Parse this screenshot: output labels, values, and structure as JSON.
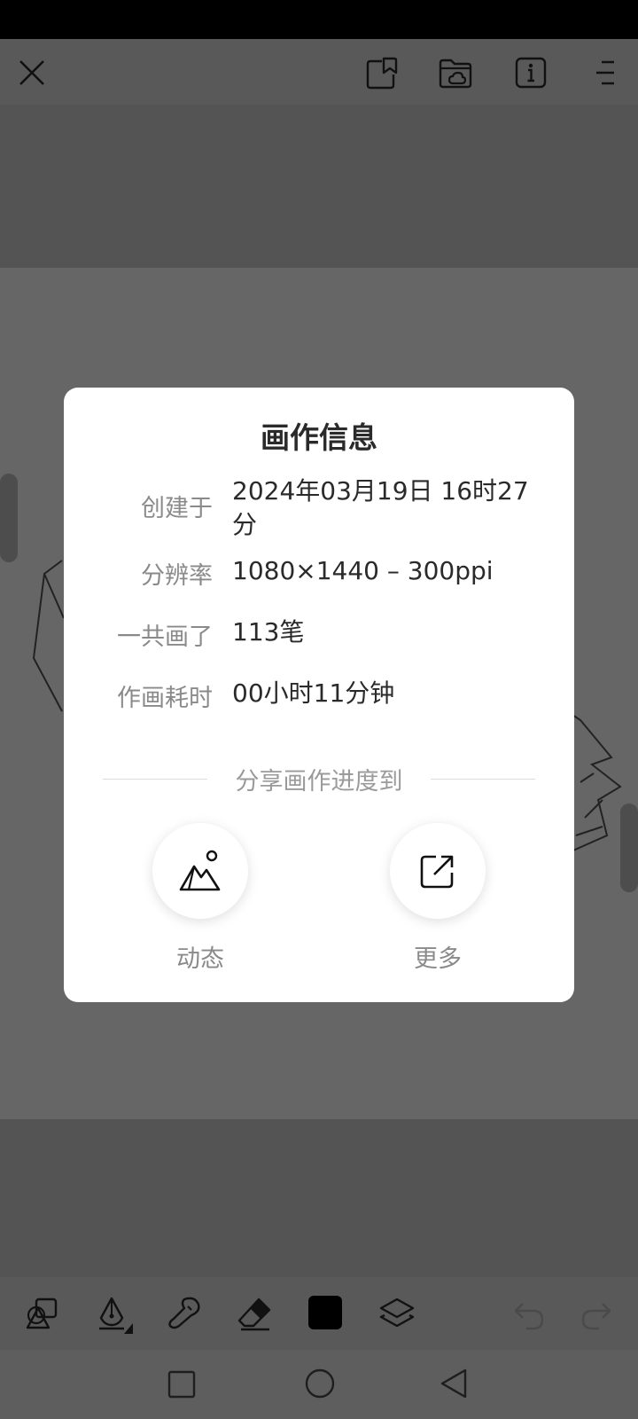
{
  "dialog": {
    "title": "画作信息",
    "rows": [
      {
        "label": "创建于",
        "value": "2024年03月19日 16时27分"
      },
      {
        "label": "分辨率",
        "value": "1080×1440 – 300ppi"
      },
      {
        "label": "一共画了",
        "value": "113笔"
      },
      {
        "label": "作画耗时",
        "value": "00小时11分钟"
      }
    ],
    "share_heading": "分享画作进度到",
    "share_options": [
      {
        "label": "动态",
        "icon": "landscape-icon"
      },
      {
        "label": "更多",
        "icon": "share-external-icon"
      }
    ]
  },
  "top_toolbar": {
    "icons": [
      "close-icon",
      "gallery-icon",
      "folder-cloud-icon",
      "info-icon",
      "menu-icon"
    ]
  },
  "bottom_toolbar": {
    "tools": [
      "shapes-icon",
      "pen-icon",
      "smudge-icon",
      "eraser-icon",
      "color-swatch",
      "layers-icon",
      "undo-icon",
      "redo-icon"
    ],
    "current_color": "#000000"
  },
  "nav": {
    "icons": [
      "recents-square-icon",
      "home-circle-icon",
      "back-triangle-icon"
    ]
  },
  "colors": {
    "dialog_bg": "#ffffff",
    "overlay": "#666666",
    "toolbar": "#595959"
  }
}
